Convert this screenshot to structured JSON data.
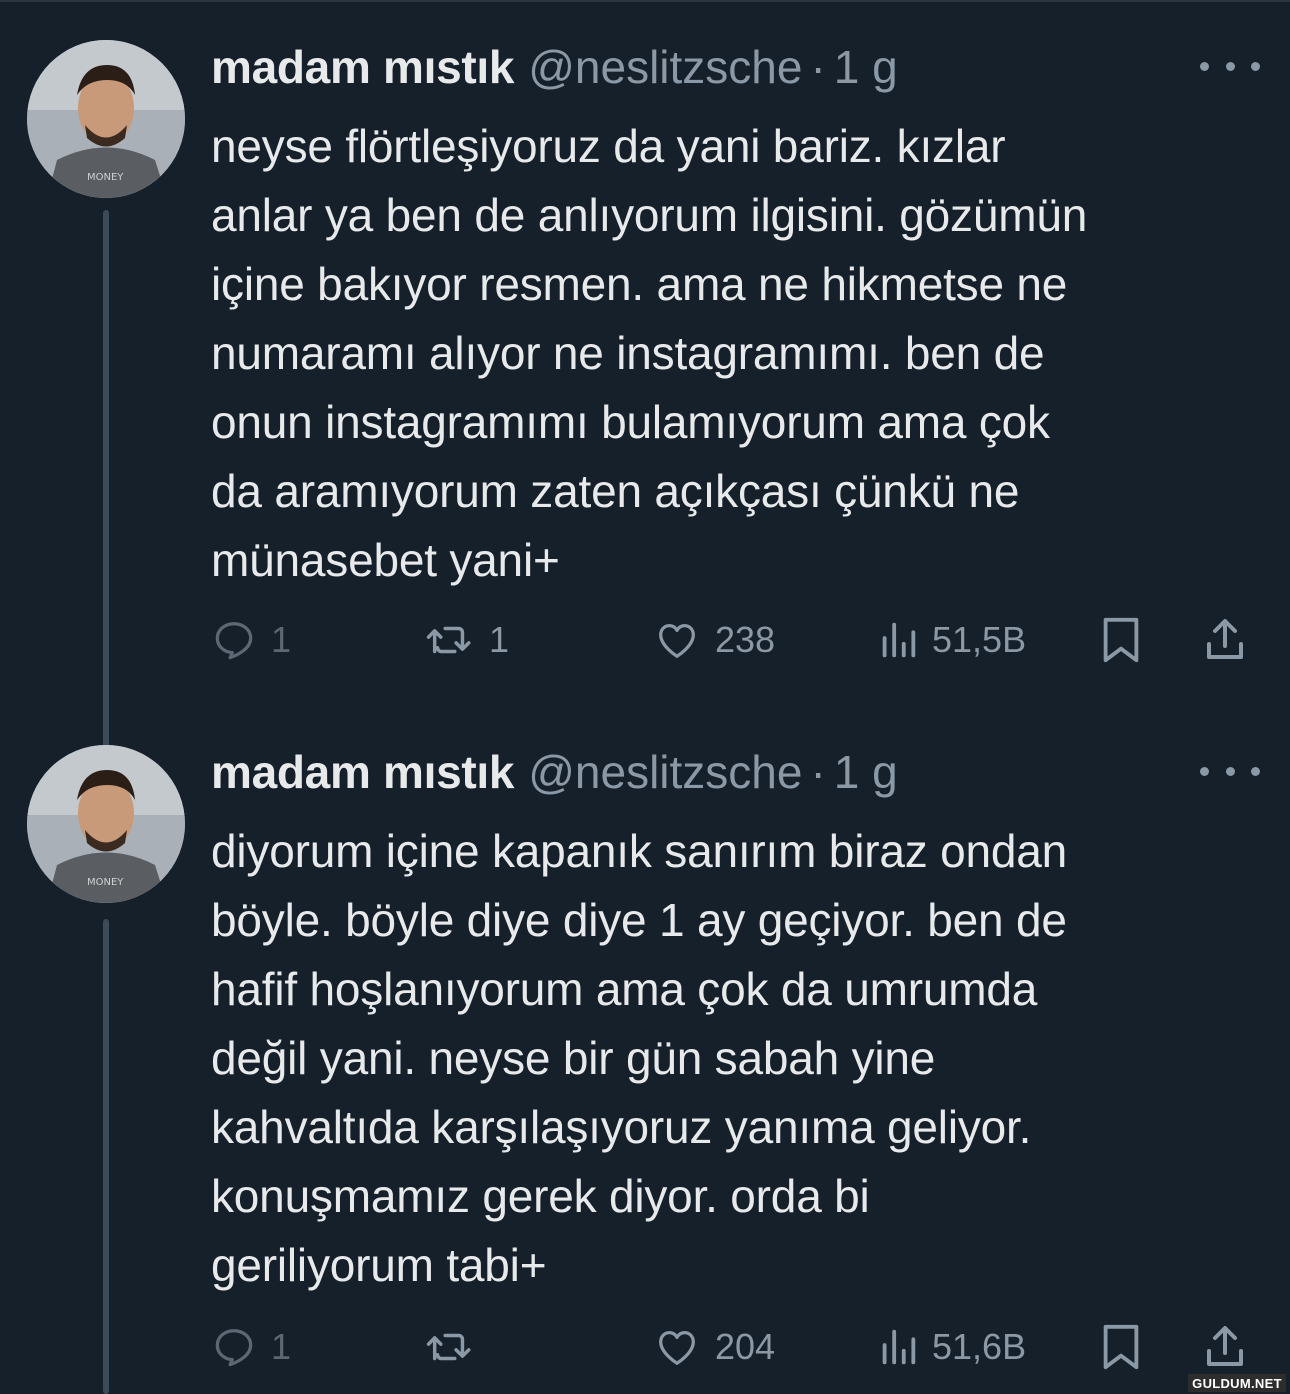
{
  "tweets": [
    {
      "author": {
        "name": "madam mıstık",
        "handle": "@neslitzsche",
        "separator": "·",
        "time": "1 g"
      },
      "text_lines": [
        "neyse flörtleşiyoruz da yani bariz. kızlar",
        "anlar ya ben de anlıyorum ilgisini. gözümün",
        "içine bakıyor resmen. ama ne hikmetse ne",
        "numaramı alıyor ne instagramımı. ben de",
        "onun instagramımı bulamıyorum ama çok",
        "da aramıyorum zaten açıkçası çünkü ne",
        "münasebet yani+"
      ],
      "stats": {
        "replies": "1",
        "retweets": "1",
        "likes": "238",
        "views": "51,5B"
      }
    },
    {
      "author": {
        "name": "madam mıstık",
        "handle": "@neslitzsche",
        "separator": "·",
        "time": "1 g"
      },
      "text_lines": [
        "diyorum içine kapanık sanırım biraz ondan",
        "böyle. böyle diye diye 1 ay geçiyor. ben de",
        "hafif hoşlanıyorum ama çok da umrumda",
        "değil yani. neyse bir gün sabah yine",
        "kahvaltıda karşılaşıyoruz yanıma geliyor.",
        "konuşmamız gerek diyor. orda bi",
        "geriliyorum tabi+"
      ],
      "stats": {
        "replies": "1",
        "retweets": "",
        "likes": "204",
        "views": "51,6B"
      }
    }
  ],
  "icons": {
    "reply": "reply-icon",
    "retweet": "retweet-icon",
    "like": "heart-icon",
    "views": "views-icon",
    "bookmark": "bookmark-icon",
    "share": "share-icon",
    "more": "more-dots-icon"
  },
  "colors": {
    "background": "#15202b",
    "text": "#e7e9ea",
    "secondary": "#8b98a5"
  },
  "watermark": "GULDUM.NET"
}
